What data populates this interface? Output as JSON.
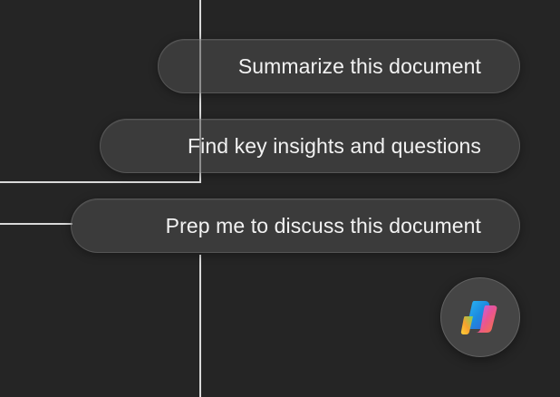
{
  "suggestions": [
    {
      "label": "Summarize this document"
    },
    {
      "label": "Find key insights and questions"
    },
    {
      "label": "Prep me to discuss this document"
    }
  ],
  "copilot": {
    "icon": "copilot-icon"
  },
  "colors": {
    "background": "#252525",
    "chip_background": "#4e4e4e",
    "chip_text": "#f2f2f2",
    "guide_line": "#d9d9d9"
  }
}
